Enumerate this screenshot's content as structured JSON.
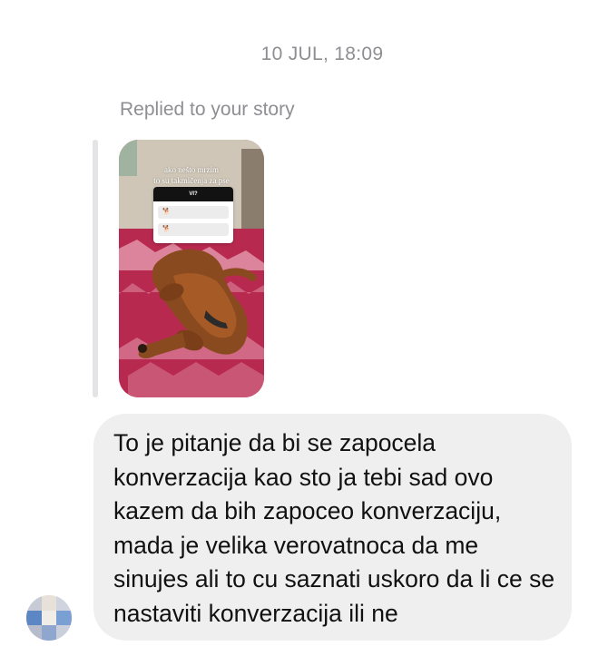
{
  "conversation": {
    "timestamp": "10 JUL, 18:09",
    "reply_label": "Replied to your story",
    "story": {
      "caption_line1": "ako nešto mrzim",
      "caption_line2": "to su takmičenja za pse",
      "poll_question": "VI?",
      "poll_option1_icon": "dog-emoji",
      "poll_option2_icon": "dog-emoji"
    },
    "message": {
      "text": "To je pitanje da bi se zapocela konverzacija kao sto ja tebi sad ovo kazem da bih zapoceo konverzaciju, mada je velika verovatnoca da me sinujes ali to cu saznati uskoro da li ce se nastaviti konverzacija ili ne"
    },
    "sender_avatar": "blurred-avatar"
  },
  "colors": {
    "background": "#ffffff",
    "meta_text": "#8e8e93",
    "bubble_bg": "#efefef",
    "message_text": "#111111",
    "story_blanket": "#b8294f"
  }
}
